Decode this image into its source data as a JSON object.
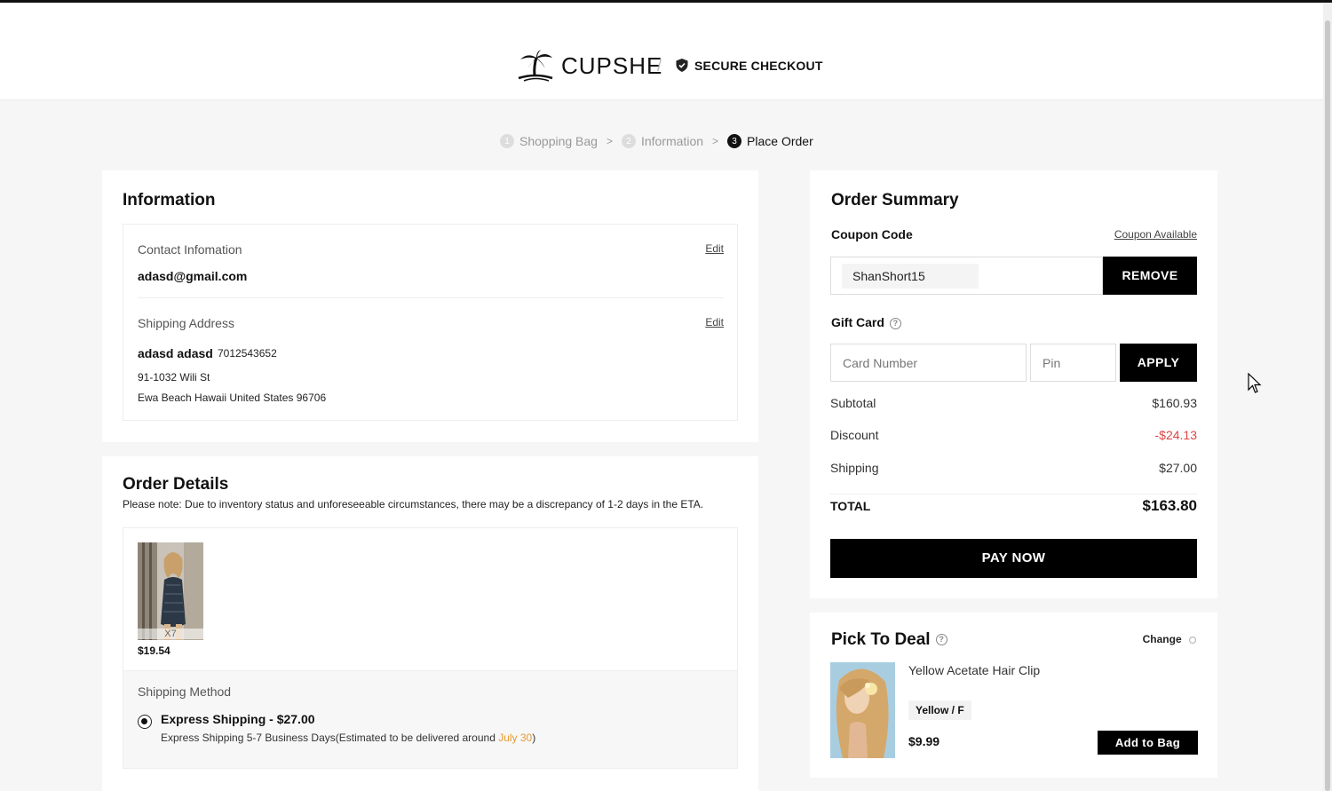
{
  "header": {
    "brand": "CUPSHE",
    "separator": "/",
    "secure_label": "SECURE CHECKOUT"
  },
  "breadcrumb": [
    {
      "num": "1",
      "label": "Shopping Bag"
    },
    {
      "num": "2",
      "label": "Information"
    },
    {
      "num": "3",
      "label": "Place Order"
    }
  ],
  "breadcrumb_arrow": ">",
  "information": {
    "title": "Information",
    "contact_label": "Contact Infomation",
    "contact_edit": "Edit",
    "email": "adasd@gmail.com",
    "shipping_label": "Shipping Address",
    "shipping_edit": "Edit",
    "name": "adasd adasd",
    "phone": "7012543652",
    "address_line1": "91-1032 Wili St",
    "address_line2": "Ewa Beach Hawaii United States 96706"
  },
  "order_details": {
    "title": "Order Details",
    "note": "Please note: Due to inventory status and unforeseeable circumstances, there may be a discrepancy of 1-2 days in the ETA.",
    "item": {
      "qty": "X7",
      "price": "$19.54"
    },
    "shipping_method_label": "Shipping Method",
    "shipping_option": {
      "name": "Express Shipping  -  $27.00",
      "desc_prefix": "Express Shipping 5-7 Business Days(Estimated to be delivered around ",
      "date": "July 30",
      "desc_suffix": ")"
    }
  },
  "summary": {
    "title": "Order Summary",
    "coupon_label": "Coupon Code",
    "coupon_available": "Coupon Available",
    "coupon_value": "ShanShort15",
    "remove_label": "REMOVE",
    "gift_label": "Gift Card",
    "gift_help": "?",
    "card_placeholder": "Card Number",
    "pin_placeholder": "Pin",
    "apply_label": "APPLY",
    "subtotal_label": "Subtotal",
    "subtotal": "$160.93",
    "discount_label": "Discount",
    "discount": "-$24.13",
    "shipping_label": "Shipping",
    "shipping": "$27.00",
    "total_label": "TOTAL",
    "total": "$163.80",
    "pay_label": "PAY NOW"
  },
  "deal": {
    "title": "Pick To Deal",
    "help": "?",
    "change_label": "Change",
    "product_name": "Yellow Acetate Hair Clip",
    "variant": "Yellow / F",
    "price": "$9.99",
    "add_label": "Add to Bag"
  },
  "colors": {
    "accent": "#000000",
    "discount": "#e04444",
    "date_highlight": "#e69a2e"
  }
}
